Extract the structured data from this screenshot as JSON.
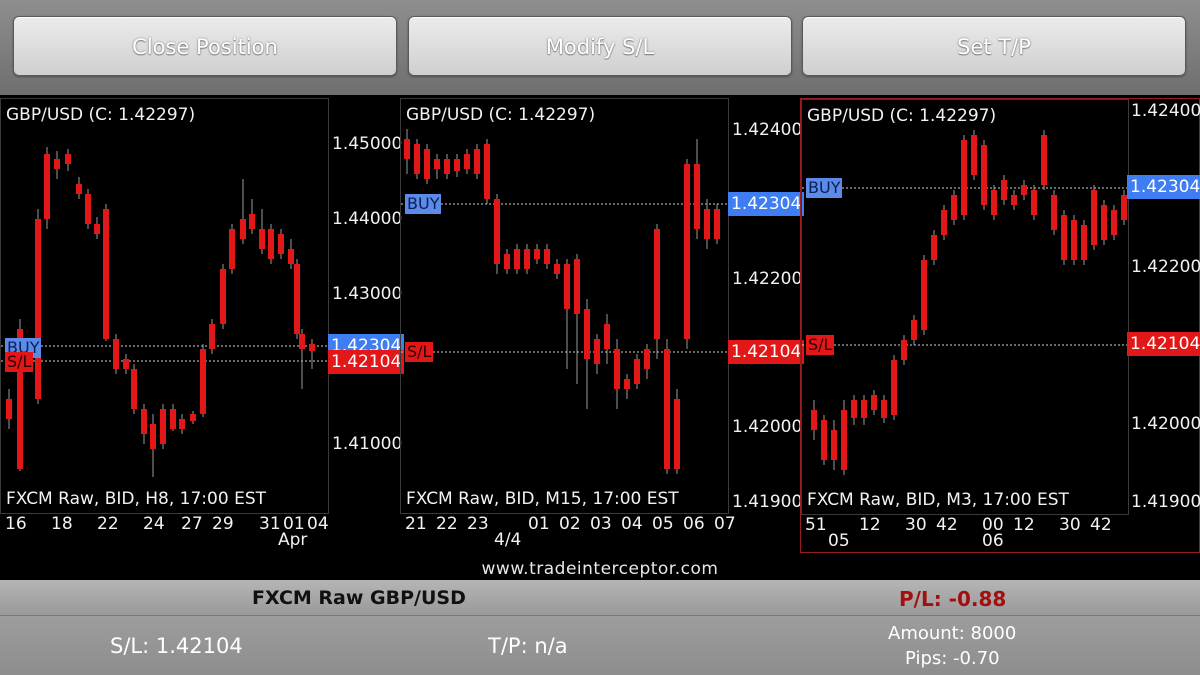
{
  "toolbar": {
    "close_position_label": "Close Position",
    "modify_sl_label": "Modify S/L",
    "set_tp_label": "Set T/P"
  },
  "colors": {
    "bull": "#8ae62c",
    "bear": "#e21818",
    "buy_tag": "#3f7df2",
    "sl_tag": "#e21818",
    "pl_negative": "#a30f0f",
    "selected_border": "#9b1c1c"
  },
  "charts": [
    {
      "title": "GBP/USD (C: 1.42297)",
      "info": "FXCM Raw, BID, H8, 17:00 EST",
      "y_ticks": [
        {
          "label": "1.45000",
          "value": 1.45
        },
        {
          "label": "1.44000",
          "value": 1.44
        },
        {
          "label": "1.43000",
          "value": 1.43
        },
        {
          "label": "1.41000",
          "value": 1.41
        }
      ],
      "x_ticks": [
        "16",
        "18",
        "22",
        "24",
        "27",
        "29",
        "31",
        "01",
        "04"
      ],
      "x_subtick": "Apr",
      "buy_label": "BUY",
      "sl_label": "S/L",
      "buy_price": "1.42304",
      "sl_price": "1.42104",
      "selected": false
    },
    {
      "title": "GBP/USD (C: 1.42297)",
      "info": "FXCM Raw, BID, M15, 17:00 EST",
      "y_ticks": [
        {
          "label": "1.42400",
          "value": 1.424
        },
        {
          "label": "1.42200",
          "value": 1.422
        },
        {
          "label": "1.42000",
          "value": 1.42
        },
        {
          "label": "1.41900",
          "value": 1.419
        }
      ],
      "x_ticks": [
        "21",
        "22",
        "23",
        "01",
        "02",
        "03",
        "04",
        "05",
        "06",
        "07"
      ],
      "x_subtick": "4/4",
      "buy_label": "BUY",
      "sl_label": "S/L",
      "buy_price": "1.42304",
      "sl_price": "1.42104",
      "selected": false
    },
    {
      "title": "GBP/USD (C: 1.42297)",
      "info": "FXCM Raw, BID, M3, 17:00 EST",
      "y_ticks": [
        {
          "label": "1.42400",
          "value": 1.424
        },
        {
          "label": "1.42200",
          "value": 1.422
        },
        {
          "label": "1.42000",
          "value": 1.42
        },
        {
          "label": "1.41900",
          "value": 1.419
        }
      ],
      "x_ticks": [
        "51",
        "12",
        "30",
        "42",
        "00",
        "12",
        "30",
        "42"
      ],
      "x_subticks": [
        "05",
        "06"
      ],
      "buy_label": "BUY",
      "sl_label": "S/L",
      "buy_price": "1.42304",
      "sl_price": "1.42104",
      "selected": true
    }
  ],
  "watermark": "www.tradeinterceptor.com",
  "position": {
    "instrument": "FXCM Raw GBP/USD",
    "pl": "P/L: -0.88",
    "sl": "S/L: 1.42104",
    "tp": "T/P: n/a",
    "amount": "Amount: 8000",
    "pips": "Pips: -0.70"
  }
}
